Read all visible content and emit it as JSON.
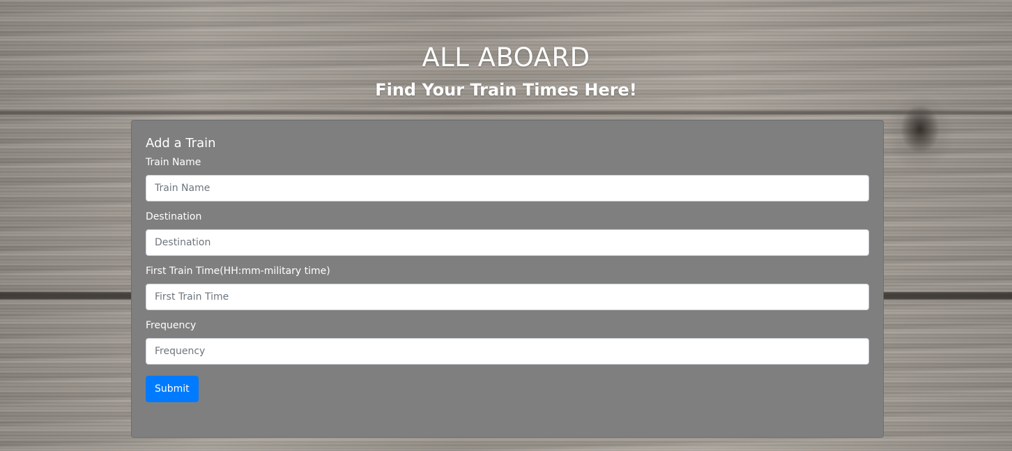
{
  "header": {
    "title": "ALL ABOARD",
    "subtitle": "Find Your Train Times Here!"
  },
  "form": {
    "card_title": "Add a Train",
    "fields": [
      {
        "label": "Train Name",
        "placeholder": "Train Name",
        "value": ""
      },
      {
        "label": "Destination",
        "placeholder": "Destination",
        "value": ""
      },
      {
        "label": "First Train Time(HH:mm-military time)",
        "placeholder": "First Train Time",
        "value": ""
      },
      {
        "label": "Frequency",
        "placeholder": "Frequency",
        "value": ""
      }
    ],
    "submit_label": "Submit"
  },
  "colors": {
    "card_background": "#7f7f7f",
    "submit_button": "#007bff",
    "text": "#ffffff"
  }
}
